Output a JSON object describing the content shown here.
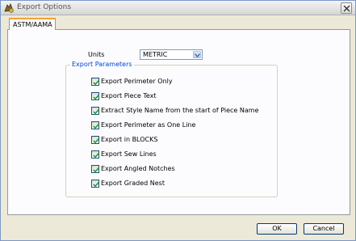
{
  "window": {
    "title": "Export Options"
  },
  "tabs": [
    {
      "label": "ASTM/AAMA",
      "active": true
    }
  ],
  "units": {
    "label": "Units",
    "selected": "METRIC"
  },
  "export_parameters": {
    "legend": "Export Parameters",
    "options": [
      {
        "label": "Export Perimeter Only",
        "checked": true
      },
      {
        "label": "Export Piece Text",
        "checked": true
      },
      {
        "label": "Extract Style Name from the start of Piece Name",
        "checked": true
      },
      {
        "label": "Export Perimeter as One Line",
        "checked": true
      },
      {
        "label": "Export in BLOCKS",
        "checked": true
      },
      {
        "label": "Export Sew Lines",
        "checked": true
      },
      {
        "label": "Export Angled Notches",
        "checked": true
      },
      {
        "label": "Export Graded Nest",
        "checked": true
      }
    ]
  },
  "buttons": {
    "ok": "OK",
    "cancel": "Cancel"
  },
  "colors": {
    "accent_tab": "#f2a33a",
    "legend_text": "#0046d5",
    "check": "#21a121"
  }
}
